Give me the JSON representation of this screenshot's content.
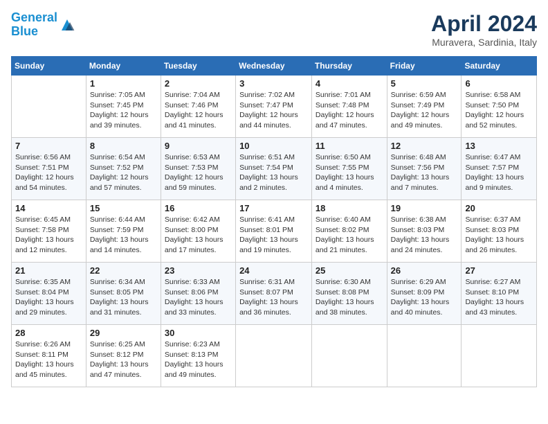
{
  "header": {
    "logo_line1": "General",
    "logo_line2": "Blue",
    "month_title": "April 2024",
    "location": "Muravera, Sardinia, Italy"
  },
  "days_of_week": [
    "Sunday",
    "Monday",
    "Tuesday",
    "Wednesday",
    "Thursday",
    "Friday",
    "Saturday"
  ],
  "weeks": [
    [
      {
        "day": "",
        "sunrise": "",
        "sunset": "",
        "daylight": ""
      },
      {
        "day": "1",
        "sunrise": "7:05 AM",
        "sunset": "7:45 PM",
        "daylight": "12 hours and 39 minutes."
      },
      {
        "day": "2",
        "sunrise": "7:04 AM",
        "sunset": "7:46 PM",
        "daylight": "12 hours and 41 minutes."
      },
      {
        "day": "3",
        "sunrise": "7:02 AM",
        "sunset": "7:47 PM",
        "daylight": "12 hours and 44 minutes."
      },
      {
        "day": "4",
        "sunrise": "7:01 AM",
        "sunset": "7:48 PM",
        "daylight": "12 hours and 47 minutes."
      },
      {
        "day": "5",
        "sunrise": "6:59 AM",
        "sunset": "7:49 PM",
        "daylight": "12 hours and 49 minutes."
      },
      {
        "day": "6",
        "sunrise": "6:58 AM",
        "sunset": "7:50 PM",
        "daylight": "12 hours and 52 minutes."
      }
    ],
    [
      {
        "day": "7",
        "sunrise": "6:56 AM",
        "sunset": "7:51 PM",
        "daylight": "12 hours and 54 minutes."
      },
      {
        "day": "8",
        "sunrise": "6:54 AM",
        "sunset": "7:52 PM",
        "daylight": "12 hours and 57 minutes."
      },
      {
        "day": "9",
        "sunrise": "6:53 AM",
        "sunset": "7:53 PM",
        "daylight": "12 hours and 59 minutes."
      },
      {
        "day": "10",
        "sunrise": "6:51 AM",
        "sunset": "7:54 PM",
        "daylight": "13 hours and 2 minutes."
      },
      {
        "day": "11",
        "sunrise": "6:50 AM",
        "sunset": "7:55 PM",
        "daylight": "13 hours and 4 minutes."
      },
      {
        "day": "12",
        "sunrise": "6:48 AM",
        "sunset": "7:56 PM",
        "daylight": "13 hours and 7 minutes."
      },
      {
        "day": "13",
        "sunrise": "6:47 AM",
        "sunset": "7:57 PM",
        "daylight": "13 hours and 9 minutes."
      }
    ],
    [
      {
        "day": "14",
        "sunrise": "6:45 AM",
        "sunset": "7:58 PM",
        "daylight": "13 hours and 12 minutes."
      },
      {
        "day": "15",
        "sunrise": "6:44 AM",
        "sunset": "7:59 PM",
        "daylight": "13 hours and 14 minutes."
      },
      {
        "day": "16",
        "sunrise": "6:42 AM",
        "sunset": "8:00 PM",
        "daylight": "13 hours and 17 minutes."
      },
      {
        "day": "17",
        "sunrise": "6:41 AM",
        "sunset": "8:01 PM",
        "daylight": "13 hours and 19 minutes."
      },
      {
        "day": "18",
        "sunrise": "6:40 AM",
        "sunset": "8:02 PM",
        "daylight": "13 hours and 21 minutes."
      },
      {
        "day": "19",
        "sunrise": "6:38 AM",
        "sunset": "8:03 PM",
        "daylight": "13 hours and 24 minutes."
      },
      {
        "day": "20",
        "sunrise": "6:37 AM",
        "sunset": "8:03 PM",
        "daylight": "13 hours and 26 minutes."
      }
    ],
    [
      {
        "day": "21",
        "sunrise": "6:35 AM",
        "sunset": "8:04 PM",
        "daylight": "13 hours and 29 minutes."
      },
      {
        "day": "22",
        "sunrise": "6:34 AM",
        "sunset": "8:05 PM",
        "daylight": "13 hours and 31 minutes."
      },
      {
        "day": "23",
        "sunrise": "6:33 AM",
        "sunset": "8:06 PM",
        "daylight": "13 hours and 33 minutes."
      },
      {
        "day": "24",
        "sunrise": "6:31 AM",
        "sunset": "8:07 PM",
        "daylight": "13 hours and 36 minutes."
      },
      {
        "day": "25",
        "sunrise": "6:30 AM",
        "sunset": "8:08 PM",
        "daylight": "13 hours and 38 minutes."
      },
      {
        "day": "26",
        "sunrise": "6:29 AM",
        "sunset": "8:09 PM",
        "daylight": "13 hours and 40 minutes."
      },
      {
        "day": "27",
        "sunrise": "6:27 AM",
        "sunset": "8:10 PM",
        "daylight": "13 hours and 43 minutes."
      }
    ],
    [
      {
        "day": "28",
        "sunrise": "6:26 AM",
        "sunset": "8:11 PM",
        "daylight": "13 hours and 45 minutes."
      },
      {
        "day": "29",
        "sunrise": "6:25 AM",
        "sunset": "8:12 PM",
        "daylight": "13 hours and 47 minutes."
      },
      {
        "day": "30",
        "sunrise": "6:23 AM",
        "sunset": "8:13 PM",
        "daylight": "13 hours and 49 minutes."
      },
      {
        "day": "",
        "sunrise": "",
        "sunset": "",
        "daylight": ""
      },
      {
        "day": "",
        "sunrise": "",
        "sunset": "",
        "daylight": ""
      },
      {
        "day": "",
        "sunrise": "",
        "sunset": "",
        "daylight": ""
      },
      {
        "day": "",
        "sunrise": "",
        "sunset": "",
        "daylight": ""
      }
    ]
  ]
}
